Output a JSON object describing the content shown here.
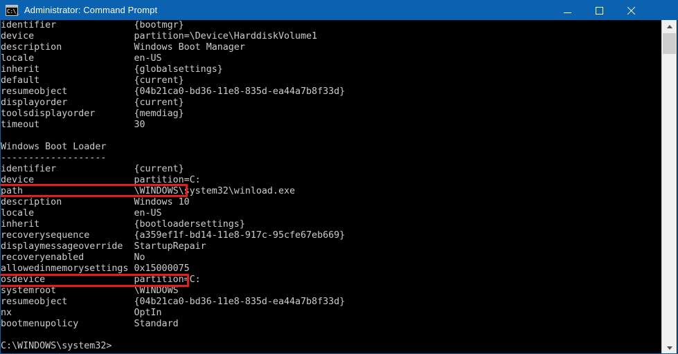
{
  "window": {
    "title": "Administrator: Command Prompt",
    "icon": "command-prompt-icon",
    "icon_glyph": "C:\\_",
    "titlebar_color": "#0a62b0",
    "console_bg": "#000000",
    "console_fg": "#cccccc",
    "highlight_color": "#e02020"
  },
  "titlebar_buttons": {
    "minimize": "minimize-button",
    "maximize": "maximize-button",
    "close": "close-button"
  },
  "scrollbar": {
    "up_arrow": "scroll-up-arrow",
    "down_arrow": "scroll-down-arrow",
    "thumb": "scroll-thumb"
  },
  "console": {
    "text": "identifier              {bootmgr}\ndevice                  partition=\\Device\\HarddiskVolume1\ndescription             Windows Boot Manager\nlocale                  en-US\ninherit                 {globalsettings}\ndefault                 {current}\nresumeobject            {04b21ca0-bd36-11e8-835d-ea44a7b8f33d}\ndisplayorder            {current}\ntoolsdisplayorder       {memdiag}\ntimeout                 30\n\nWindows Boot Loader\n-------------------\nidentifier              {current}\ndevice                  partition=C:\npath                    \\WINDOWS\\system32\\winload.exe\ndescription             Windows 10\nlocale                  en-US\ninherit                 {bootloadersettings}\nrecoverysequence        {a359ef1f-bd14-11e8-917c-95cfe67eb669}\ndisplaymessageoverride  StartupRepair\nrecoveryenabled         No\nallowedinmemorysettings 0x15000075\nosdevice                partition=C:\nsystemroot              \\WINDOWS\nresumeobject            {04b21ca0-bd36-11e8-835d-ea44a7b8f33d}\nnx                      OptIn\nbootmenupolicy          Standard\n\nC:\\WINDOWS\\system32>",
    "sections": [
      {
        "heading": "",
        "entries": [
          {
            "key": "identifier",
            "value": "{bootmgr}"
          },
          {
            "key": "device",
            "value": "partition=\\Device\\HarddiskVolume1"
          },
          {
            "key": "description",
            "value": "Windows Boot Manager"
          },
          {
            "key": "locale",
            "value": "en-US"
          },
          {
            "key": "inherit",
            "value": "{globalsettings}"
          },
          {
            "key": "default",
            "value": "{current}"
          },
          {
            "key": "resumeobject",
            "value": "{04b21ca0-bd36-11e8-835d-ea44a7b8f33d}"
          },
          {
            "key": "displayorder",
            "value": "{current}"
          },
          {
            "key": "toolsdisplayorder",
            "value": "{memdiag}"
          },
          {
            "key": "timeout",
            "value": "30"
          }
        ]
      },
      {
        "heading": "Windows Boot Loader",
        "separator": "-------------------",
        "entries": [
          {
            "key": "identifier",
            "value": "{current}",
            "highlighted": true
          },
          {
            "key": "device",
            "value": "partition=C:"
          },
          {
            "key": "path",
            "value": "\\WINDOWS\\system32\\winload.exe"
          },
          {
            "key": "description",
            "value": "Windows 10"
          },
          {
            "key": "locale",
            "value": "en-US"
          },
          {
            "key": "inherit",
            "value": "{bootloadersettings}"
          },
          {
            "key": "recoverysequence",
            "value": "{a359ef1f-bd14-11e8-917c-95cfe67eb669}"
          },
          {
            "key": "displaymessageoverride",
            "value": "StartupRepair"
          },
          {
            "key": "recoveryenabled",
            "value": "No",
            "highlighted": true
          },
          {
            "key": "allowedinmemorysettings",
            "value": "0x15000075"
          },
          {
            "key": "osdevice",
            "value": "partition=C:"
          },
          {
            "key": "systemroot",
            "value": "\\WINDOWS"
          },
          {
            "key": "resumeobject",
            "value": "{04b21ca0-bd36-11e8-835d-ea44a7b8f33d}"
          },
          {
            "key": "nx",
            "value": "OptIn"
          },
          {
            "key": "bootmenupolicy",
            "value": "Standard"
          }
        ]
      }
    ],
    "prompt": "C:\\WINDOWS\\system32>"
  }
}
